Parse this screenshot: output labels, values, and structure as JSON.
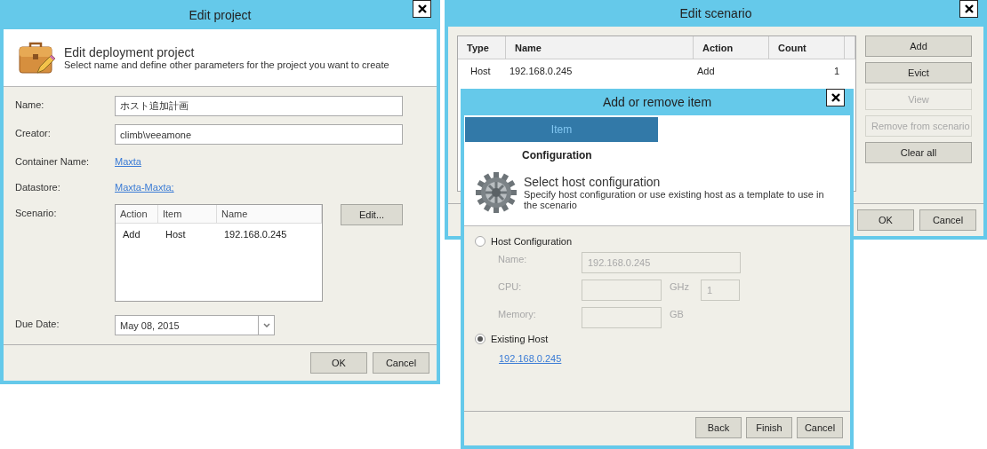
{
  "edit_project": {
    "title": "Edit project",
    "header": {
      "title": "Edit deployment project",
      "subtitle": "Select name and define other parameters for the project you want to create"
    },
    "fields": [
      {
        "label": "Name:",
        "kind": "text",
        "value": "ホスト追加計画"
      },
      {
        "label": "Creator:",
        "kind": "text",
        "value": "climb\\veeamone"
      },
      {
        "label": "Container Name:",
        "kind": "link",
        "value": "Maxta"
      },
      {
        "label": "Datastore:",
        "kind": "link",
        "value": "Maxta-Maxta;"
      }
    ],
    "scenario": {
      "label": "Scenario:",
      "columns": [
        "Action",
        "Item",
        "Name"
      ],
      "rows": [
        [
          "Add",
          "Host",
          "192.168.0.245"
        ]
      ],
      "edit_button": "Edit..."
    },
    "due_date": {
      "label": "Due Date:",
      "value": "May 08, 2015"
    },
    "buttons": [
      "OK",
      "Cancel"
    ]
  },
  "edit_scenario": {
    "title": "Edit scenario",
    "table": {
      "columns": [
        "Type",
        "Name",
        "Action",
        "Count"
      ],
      "rows": [
        [
          "Host",
          "192.168.0.245",
          "Add",
          "1"
        ]
      ]
    },
    "side_buttons": [
      {
        "label": "Add",
        "disabled": false
      },
      {
        "label": "Evict",
        "disabled": false
      },
      {
        "label": "View",
        "disabled": true
      },
      {
        "label": "Remove from scenario",
        "disabled": true
      },
      {
        "label": "Clear all",
        "disabled": false
      }
    ],
    "buttons": [
      "OK",
      "Cancel"
    ]
  },
  "add_remove_dialog": {
    "title": "Add or remove item",
    "steps": [
      {
        "label": "Item",
        "selected": true
      }
    ],
    "section": "Configuration",
    "header": {
      "title": "Select host configuration",
      "subtitle": "Specify host configuration or use existing host as a template to use in the scenario"
    },
    "options": [
      {
        "label": "Host Configuration",
        "selected": false,
        "disabled": true,
        "fields": [
          {
            "label": "Name:",
            "value": "192.168.0.245"
          },
          {
            "label": "CPU:",
            "unit": "GHz",
            "count": "1"
          },
          {
            "label": "Memory:",
            "unit": "GB"
          }
        ]
      },
      {
        "label": "Existing Host",
        "selected": true,
        "link": "192.168.0.245"
      }
    ],
    "buttons": [
      "Back",
      "Finish",
      "Cancel"
    ]
  }
}
